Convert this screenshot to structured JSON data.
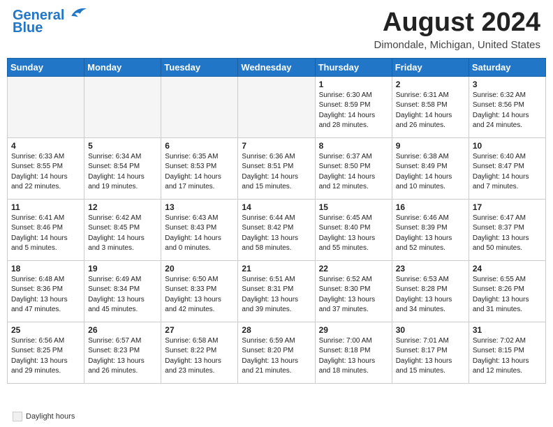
{
  "header": {
    "logo_line1": "General",
    "logo_line2": "Blue",
    "main_title": "August 2024",
    "subtitle": "Dimondale, Michigan, United States"
  },
  "days_of_week": [
    "Sunday",
    "Monday",
    "Tuesday",
    "Wednesday",
    "Thursday",
    "Friday",
    "Saturday"
  ],
  "weeks": [
    [
      {
        "num": "",
        "info": "",
        "empty": true
      },
      {
        "num": "",
        "info": "",
        "empty": true
      },
      {
        "num": "",
        "info": "",
        "empty": true
      },
      {
        "num": "",
        "info": "",
        "empty": true
      },
      {
        "num": "1",
        "info": "Sunrise: 6:30 AM\nSunset: 8:59 PM\nDaylight: 14 hours\nand 28 minutes."
      },
      {
        "num": "2",
        "info": "Sunrise: 6:31 AM\nSunset: 8:58 PM\nDaylight: 14 hours\nand 26 minutes."
      },
      {
        "num": "3",
        "info": "Sunrise: 6:32 AM\nSunset: 8:56 PM\nDaylight: 14 hours\nand 24 minutes."
      }
    ],
    [
      {
        "num": "4",
        "info": "Sunrise: 6:33 AM\nSunset: 8:55 PM\nDaylight: 14 hours\nand 22 minutes."
      },
      {
        "num": "5",
        "info": "Sunrise: 6:34 AM\nSunset: 8:54 PM\nDaylight: 14 hours\nand 19 minutes."
      },
      {
        "num": "6",
        "info": "Sunrise: 6:35 AM\nSunset: 8:53 PM\nDaylight: 14 hours\nand 17 minutes."
      },
      {
        "num": "7",
        "info": "Sunrise: 6:36 AM\nSunset: 8:51 PM\nDaylight: 14 hours\nand 15 minutes."
      },
      {
        "num": "8",
        "info": "Sunrise: 6:37 AM\nSunset: 8:50 PM\nDaylight: 14 hours\nand 12 minutes."
      },
      {
        "num": "9",
        "info": "Sunrise: 6:38 AM\nSunset: 8:49 PM\nDaylight: 14 hours\nand 10 minutes."
      },
      {
        "num": "10",
        "info": "Sunrise: 6:40 AM\nSunset: 8:47 PM\nDaylight: 14 hours\nand 7 minutes."
      }
    ],
    [
      {
        "num": "11",
        "info": "Sunrise: 6:41 AM\nSunset: 8:46 PM\nDaylight: 14 hours\nand 5 minutes."
      },
      {
        "num": "12",
        "info": "Sunrise: 6:42 AM\nSunset: 8:45 PM\nDaylight: 14 hours\nand 3 minutes."
      },
      {
        "num": "13",
        "info": "Sunrise: 6:43 AM\nSunset: 8:43 PM\nDaylight: 14 hours\nand 0 minutes."
      },
      {
        "num": "14",
        "info": "Sunrise: 6:44 AM\nSunset: 8:42 PM\nDaylight: 13 hours\nand 58 minutes."
      },
      {
        "num": "15",
        "info": "Sunrise: 6:45 AM\nSunset: 8:40 PM\nDaylight: 13 hours\nand 55 minutes."
      },
      {
        "num": "16",
        "info": "Sunrise: 6:46 AM\nSunset: 8:39 PM\nDaylight: 13 hours\nand 52 minutes."
      },
      {
        "num": "17",
        "info": "Sunrise: 6:47 AM\nSunset: 8:37 PM\nDaylight: 13 hours\nand 50 minutes."
      }
    ],
    [
      {
        "num": "18",
        "info": "Sunrise: 6:48 AM\nSunset: 8:36 PM\nDaylight: 13 hours\nand 47 minutes."
      },
      {
        "num": "19",
        "info": "Sunrise: 6:49 AM\nSunset: 8:34 PM\nDaylight: 13 hours\nand 45 minutes."
      },
      {
        "num": "20",
        "info": "Sunrise: 6:50 AM\nSunset: 8:33 PM\nDaylight: 13 hours\nand 42 minutes."
      },
      {
        "num": "21",
        "info": "Sunrise: 6:51 AM\nSunset: 8:31 PM\nDaylight: 13 hours\nand 39 minutes."
      },
      {
        "num": "22",
        "info": "Sunrise: 6:52 AM\nSunset: 8:30 PM\nDaylight: 13 hours\nand 37 minutes."
      },
      {
        "num": "23",
        "info": "Sunrise: 6:53 AM\nSunset: 8:28 PM\nDaylight: 13 hours\nand 34 minutes."
      },
      {
        "num": "24",
        "info": "Sunrise: 6:55 AM\nSunset: 8:26 PM\nDaylight: 13 hours\nand 31 minutes."
      }
    ],
    [
      {
        "num": "25",
        "info": "Sunrise: 6:56 AM\nSunset: 8:25 PM\nDaylight: 13 hours\nand 29 minutes."
      },
      {
        "num": "26",
        "info": "Sunrise: 6:57 AM\nSunset: 8:23 PM\nDaylight: 13 hours\nand 26 minutes."
      },
      {
        "num": "27",
        "info": "Sunrise: 6:58 AM\nSunset: 8:22 PM\nDaylight: 13 hours\nand 23 minutes."
      },
      {
        "num": "28",
        "info": "Sunrise: 6:59 AM\nSunset: 8:20 PM\nDaylight: 13 hours\nand 21 minutes."
      },
      {
        "num": "29",
        "info": "Sunrise: 7:00 AM\nSunset: 8:18 PM\nDaylight: 13 hours\nand 18 minutes."
      },
      {
        "num": "30",
        "info": "Sunrise: 7:01 AM\nSunset: 8:17 PM\nDaylight: 13 hours\nand 15 minutes."
      },
      {
        "num": "31",
        "info": "Sunrise: 7:02 AM\nSunset: 8:15 PM\nDaylight: 13 hours\nand 12 minutes."
      }
    ]
  ],
  "footer": {
    "legend_label": "Daylight hours"
  }
}
